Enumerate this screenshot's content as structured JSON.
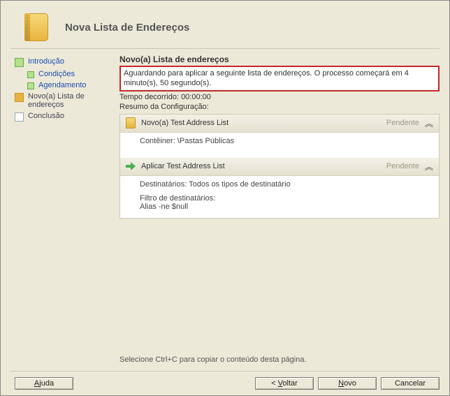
{
  "header": {
    "title": "Nova Lista de Endereços"
  },
  "sidebar": {
    "items": [
      {
        "label": "Introdução",
        "state": "done",
        "link": true
      },
      {
        "label": "Condições",
        "state": "done",
        "link": true,
        "sub": true
      },
      {
        "label": "Agendamento",
        "state": "done",
        "link": true,
        "sub": true
      },
      {
        "label": "Novo(a) Lista de endereços",
        "state": "current",
        "link": false
      },
      {
        "label": "Conclusão",
        "state": "pending",
        "link": false
      }
    ]
  },
  "main": {
    "title": "Novo(a) Lista de endereços",
    "alert": "Aguardando para aplicar a seguinte lista de endereços. O processo começará em 4 minuto(s), 50 segundo(s).",
    "elapsed_label": "Tempo decorrido:",
    "elapsed_value": "00:00:00",
    "summary_label": "Resumo da Configuração:",
    "groups": [
      {
        "icon": "book",
        "title": "Novo(a) Test Address List",
        "status": "Pendente",
        "rows": [
          "Contêiner: \\Pastas Públicas"
        ]
      },
      {
        "icon": "arrow",
        "title": "Aplicar Test Address List",
        "status": "Pendente",
        "rows": [
          "Destinatários: Todos os tipos de destinatário",
          "",
          "Filtro de destinatários:",
          "Alias -ne $null"
        ]
      }
    ],
    "hint": "Selecione Ctrl+C para copiar o conteúdo desta página."
  },
  "footer": {
    "help": "Ajuda",
    "back": "Voltar",
    "next": "Novo",
    "cancel": "Cancelar"
  }
}
